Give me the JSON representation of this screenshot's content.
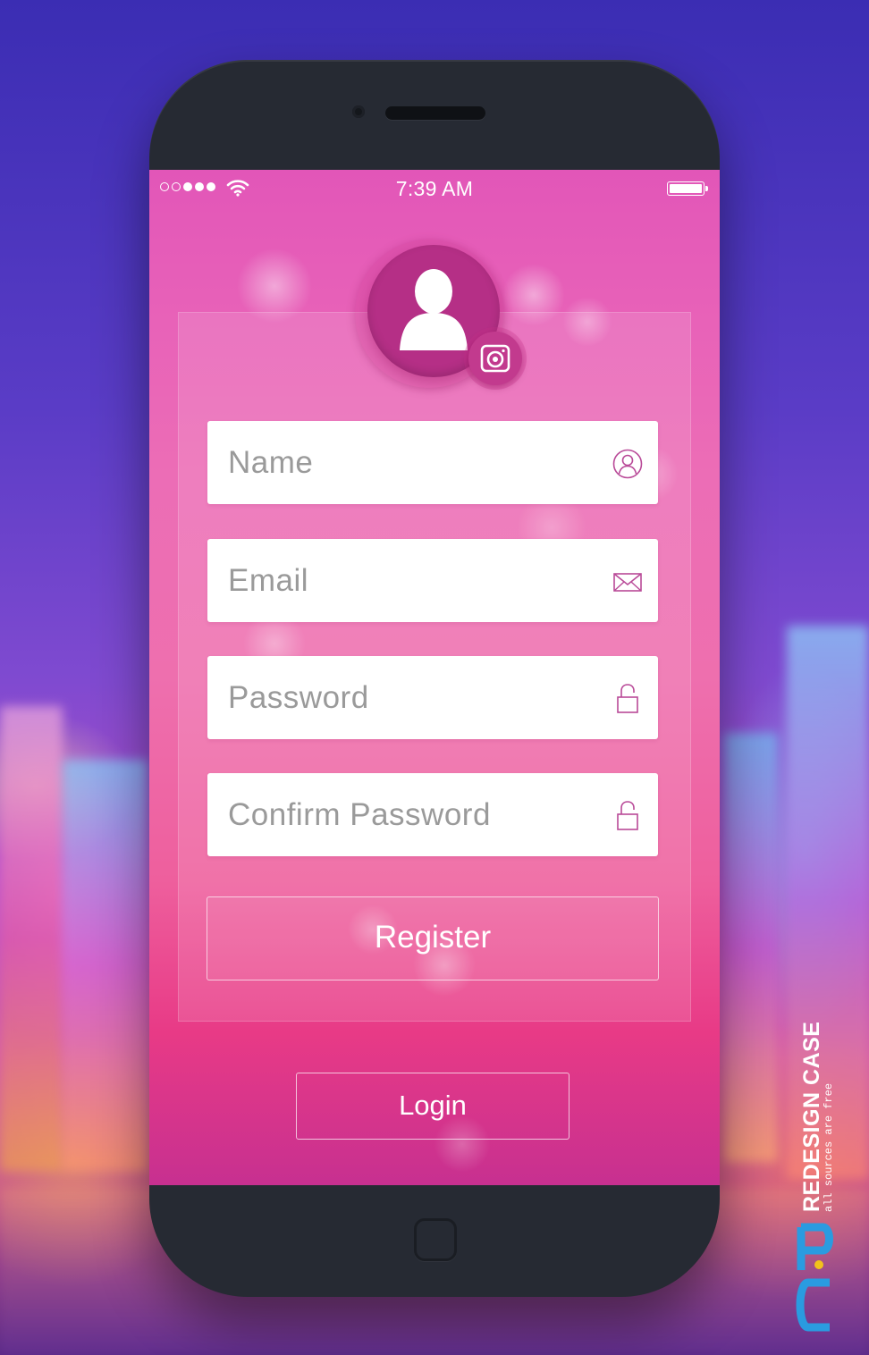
{
  "status_bar": {
    "time": "7:39 AM",
    "signal_dots": [
      false,
      false,
      true,
      true,
      true
    ]
  },
  "avatar": {
    "icon": "user-silhouette-icon",
    "badge_icon": "camera-icon"
  },
  "form": {
    "fields": [
      {
        "placeholder": "Name",
        "icon": "user-circle-icon"
      },
      {
        "placeholder": "Email",
        "icon": "envelope-icon"
      },
      {
        "placeholder": "Password",
        "icon": "lock-icon"
      },
      {
        "placeholder": "Confirm Password",
        "icon": "lock-icon"
      }
    ],
    "register_label": "Register"
  },
  "login_label": "Login",
  "watermark": {
    "title": "REDESIGN CASE",
    "subtitle": "all sources are free"
  },
  "colors": {
    "accent": "#b52f86",
    "field_text": "#9a9a9a",
    "phone_body": "#262a33"
  }
}
